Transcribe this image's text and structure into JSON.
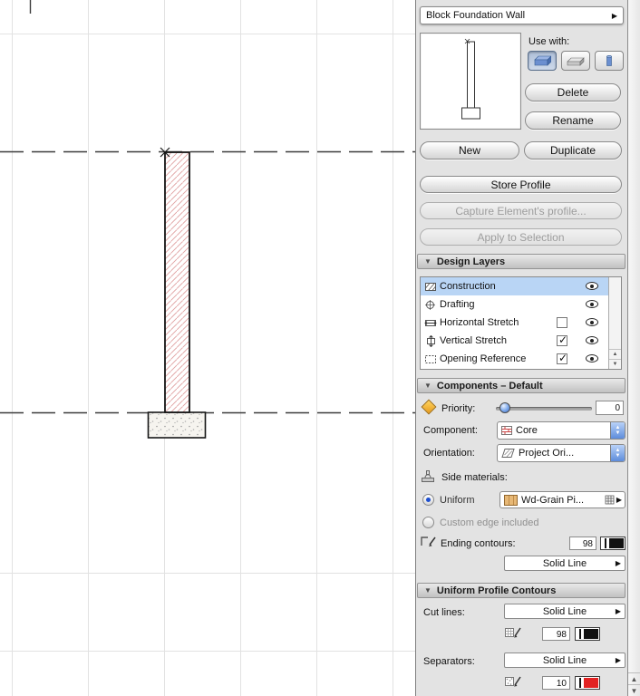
{
  "profile_selector": {
    "value": "Block Foundation Wall"
  },
  "use_with": {
    "label": "Use with:"
  },
  "actions": {
    "delete": "Delete",
    "rename": "Rename",
    "new": "New",
    "duplicate": "Duplicate",
    "store_profile": "Store Profile",
    "capture_profile": "Capture Element's profile...",
    "apply_to_selection": "Apply to Selection"
  },
  "design_layers": {
    "title": "Design Layers",
    "layers": [
      {
        "name": "Construction",
        "selected": true,
        "has_checkbox": false,
        "checked": false,
        "visible": true
      },
      {
        "name": "Drafting",
        "selected": false,
        "has_checkbox": false,
        "checked": false,
        "visible": true
      },
      {
        "name": "Horizontal Stretch",
        "selected": false,
        "has_checkbox": true,
        "checked": false,
        "visible": true
      },
      {
        "name": "Vertical Stretch",
        "selected": false,
        "has_checkbox": true,
        "checked": true,
        "visible": true
      },
      {
        "name": "Opening Reference",
        "selected": false,
        "has_checkbox": true,
        "checked": true,
        "visible": true
      }
    ]
  },
  "components": {
    "title": "Components – Default",
    "priority": {
      "label": "Priority:",
      "value": "0"
    },
    "component": {
      "label": "Component:",
      "value": "Core"
    },
    "orientation": {
      "label": "Orientation:",
      "value": "Project Ori..."
    },
    "side_materials": {
      "label": "Side materials:"
    },
    "uniform": {
      "label": "Uniform",
      "material": "Wd-Grain Pi..."
    },
    "custom_edge": {
      "label": "Custom edge included"
    },
    "ending_contours": {
      "label": "Ending contours:",
      "pen": "98",
      "line_type": "Solid Line"
    }
  },
  "uniform_profile_contours": {
    "title": "Uniform Profile Contours",
    "cut_lines": {
      "label": "Cut lines:",
      "line_type": "Solid Line",
      "pen": "98"
    },
    "separators": {
      "label": "Separators:",
      "line_type": "Solid Line",
      "pen": "10"
    },
    "colors": {
      "cut_pen_color": "#111111",
      "separator_pen_color": "#e22222",
      "selection_highlight": "#b9d5f5"
    }
  }
}
